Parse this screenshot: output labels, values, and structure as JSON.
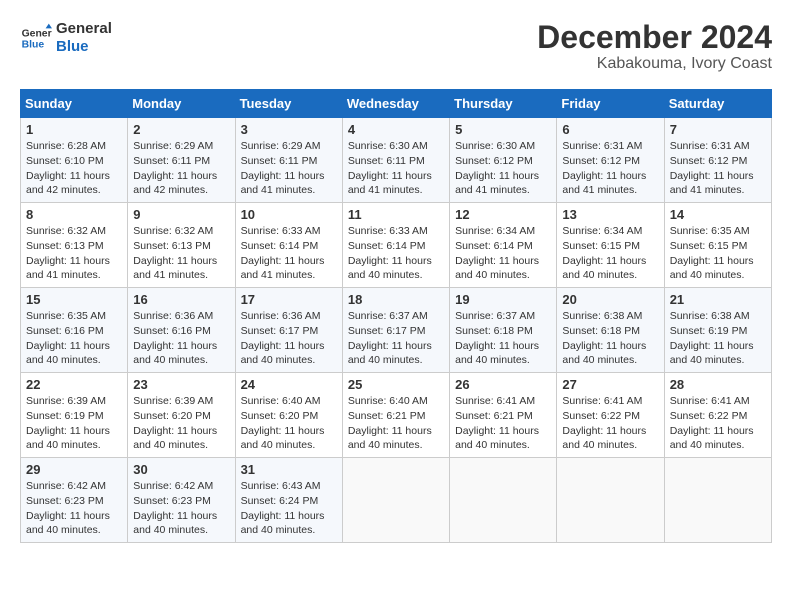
{
  "header": {
    "logo_line1": "General",
    "logo_line2": "Blue",
    "title": "December 2024",
    "subtitle": "Kabakouma, Ivory Coast"
  },
  "calendar": {
    "weekdays": [
      "Sunday",
      "Monday",
      "Tuesday",
      "Wednesday",
      "Thursday",
      "Friday",
      "Saturday"
    ],
    "weeks": [
      [
        {
          "day": "1",
          "text": "Sunrise: 6:28 AM\nSunset: 6:10 PM\nDaylight: 11 hours\nand 42 minutes."
        },
        {
          "day": "2",
          "text": "Sunrise: 6:29 AM\nSunset: 6:11 PM\nDaylight: 11 hours\nand 42 minutes."
        },
        {
          "day": "3",
          "text": "Sunrise: 6:29 AM\nSunset: 6:11 PM\nDaylight: 11 hours\nand 41 minutes."
        },
        {
          "day": "4",
          "text": "Sunrise: 6:30 AM\nSunset: 6:11 PM\nDaylight: 11 hours\nand 41 minutes."
        },
        {
          "day": "5",
          "text": "Sunrise: 6:30 AM\nSunset: 6:12 PM\nDaylight: 11 hours\nand 41 minutes."
        },
        {
          "day": "6",
          "text": "Sunrise: 6:31 AM\nSunset: 6:12 PM\nDaylight: 11 hours\nand 41 minutes."
        },
        {
          "day": "7",
          "text": "Sunrise: 6:31 AM\nSunset: 6:12 PM\nDaylight: 11 hours\nand 41 minutes."
        }
      ],
      [
        {
          "day": "8",
          "text": "Sunrise: 6:32 AM\nSunset: 6:13 PM\nDaylight: 11 hours\nand 41 minutes."
        },
        {
          "day": "9",
          "text": "Sunrise: 6:32 AM\nSunset: 6:13 PM\nDaylight: 11 hours\nand 41 minutes."
        },
        {
          "day": "10",
          "text": "Sunrise: 6:33 AM\nSunset: 6:14 PM\nDaylight: 11 hours\nand 41 minutes."
        },
        {
          "day": "11",
          "text": "Sunrise: 6:33 AM\nSunset: 6:14 PM\nDaylight: 11 hours\nand 40 minutes."
        },
        {
          "day": "12",
          "text": "Sunrise: 6:34 AM\nSunset: 6:14 PM\nDaylight: 11 hours\nand 40 minutes."
        },
        {
          "day": "13",
          "text": "Sunrise: 6:34 AM\nSunset: 6:15 PM\nDaylight: 11 hours\nand 40 minutes."
        },
        {
          "day": "14",
          "text": "Sunrise: 6:35 AM\nSunset: 6:15 PM\nDaylight: 11 hours\nand 40 minutes."
        }
      ],
      [
        {
          "day": "15",
          "text": "Sunrise: 6:35 AM\nSunset: 6:16 PM\nDaylight: 11 hours\nand 40 minutes."
        },
        {
          "day": "16",
          "text": "Sunrise: 6:36 AM\nSunset: 6:16 PM\nDaylight: 11 hours\nand 40 minutes."
        },
        {
          "day": "17",
          "text": "Sunrise: 6:36 AM\nSunset: 6:17 PM\nDaylight: 11 hours\nand 40 minutes."
        },
        {
          "day": "18",
          "text": "Sunrise: 6:37 AM\nSunset: 6:17 PM\nDaylight: 11 hours\nand 40 minutes."
        },
        {
          "day": "19",
          "text": "Sunrise: 6:37 AM\nSunset: 6:18 PM\nDaylight: 11 hours\nand 40 minutes."
        },
        {
          "day": "20",
          "text": "Sunrise: 6:38 AM\nSunset: 6:18 PM\nDaylight: 11 hours\nand 40 minutes."
        },
        {
          "day": "21",
          "text": "Sunrise: 6:38 AM\nSunset: 6:19 PM\nDaylight: 11 hours\nand 40 minutes."
        }
      ],
      [
        {
          "day": "22",
          "text": "Sunrise: 6:39 AM\nSunset: 6:19 PM\nDaylight: 11 hours\nand 40 minutes."
        },
        {
          "day": "23",
          "text": "Sunrise: 6:39 AM\nSunset: 6:20 PM\nDaylight: 11 hours\nand 40 minutes."
        },
        {
          "day": "24",
          "text": "Sunrise: 6:40 AM\nSunset: 6:20 PM\nDaylight: 11 hours\nand 40 minutes."
        },
        {
          "day": "25",
          "text": "Sunrise: 6:40 AM\nSunset: 6:21 PM\nDaylight: 11 hours\nand 40 minutes."
        },
        {
          "day": "26",
          "text": "Sunrise: 6:41 AM\nSunset: 6:21 PM\nDaylight: 11 hours\nand 40 minutes."
        },
        {
          "day": "27",
          "text": "Sunrise: 6:41 AM\nSunset: 6:22 PM\nDaylight: 11 hours\nand 40 minutes."
        },
        {
          "day": "28",
          "text": "Sunrise: 6:41 AM\nSunset: 6:22 PM\nDaylight: 11 hours\nand 40 minutes."
        }
      ],
      [
        {
          "day": "29",
          "text": "Sunrise: 6:42 AM\nSunset: 6:23 PM\nDaylight: 11 hours\nand 40 minutes."
        },
        {
          "day": "30",
          "text": "Sunrise: 6:42 AM\nSunset: 6:23 PM\nDaylight: 11 hours\nand 40 minutes."
        },
        {
          "day": "31",
          "text": "Sunrise: 6:43 AM\nSunset: 6:24 PM\nDaylight: 11 hours\nand 40 minutes."
        },
        {
          "day": "",
          "text": ""
        },
        {
          "day": "",
          "text": ""
        },
        {
          "day": "",
          "text": ""
        },
        {
          "day": "",
          "text": ""
        }
      ]
    ]
  }
}
